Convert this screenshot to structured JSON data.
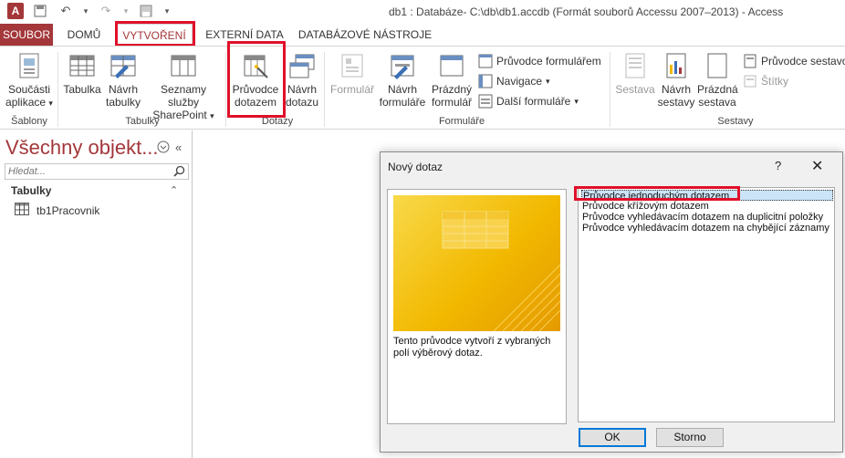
{
  "window": {
    "title": "db1 : Databáze- C:\\db\\db1.accdb (Formát souborů Accessu 2007–2013) - Access"
  },
  "quick_access": {
    "app_icon_letter": "A"
  },
  "tabs": [
    "SOUBOR",
    "DOMŮ",
    "VYTVOŘENÍ",
    "EXTERNÍ DATA",
    "DATABÁZOVÉ NÁSTROJE"
  ],
  "ribbon": {
    "templates": {
      "app_parts": "Součásti aplikace",
      "group": "Šablony"
    },
    "tables": {
      "table": "Tabulka",
      "table_design": "Návrh tabulky",
      "sharepoint": "Seznamy služby SharePoint",
      "group": "Tabulky"
    },
    "queries": {
      "query_wizard": "Průvodce dotazem",
      "query_design": "Návrh dotazu",
      "group": "Dotazy"
    },
    "forms": {
      "form": "Formulář",
      "form_design": "Návrh formuláře",
      "blank_form": "Prázdný formulář",
      "form_wizard": "Průvodce formulářem",
      "navigation": "Navigace",
      "more_forms": "Další formuláře",
      "group": "Formuláře"
    },
    "reports": {
      "report": "Sestava",
      "report_design": "Návrh sestavy",
      "blank_report": "Prázdná sestava",
      "report_wizard": "Průvodce sestavou",
      "labels": "Štítky",
      "group": "Sestavy"
    }
  },
  "nav_pane": {
    "title": "Všechny objekt...",
    "search_placeholder": "Hledat...",
    "section": "Tabulky",
    "items": [
      "tb1Pracovnik"
    ]
  },
  "dialog": {
    "title": "Nový dotaz",
    "help": "?",
    "description": "Tento průvodce vytvoří z vybraných polí výběrový dotaz.",
    "options": [
      "Průvodce jednoduchým dotazem",
      "Průvodce křížovým dotazem",
      "Průvodce vyhledávacím dotazem na duplicitní položky",
      "Průvodce vyhledávacím dotazem na chybějící záznamy"
    ],
    "selected_index": 0,
    "ok": "OK",
    "cancel": "Storno"
  },
  "colors": {
    "accent": "#a4373a",
    "highlight_box": "#e0102a",
    "selection": "#cce4f7"
  }
}
